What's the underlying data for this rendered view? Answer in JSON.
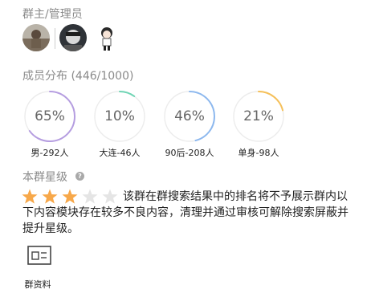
{
  "admins": {
    "title": "群主/管理员",
    "avatars": [
      {
        "kind": "photo-outdoor",
        "color": "#8d7e6e"
      },
      {
        "kind": "photo-dark",
        "color": "#4b4f55"
      },
      {
        "kind": "cartoon",
        "color": "#f1e9e5"
      }
    ]
  },
  "distribution": {
    "title": "成员分布 (446/1000)",
    "items": [
      {
        "value_text": "65%",
        "percent": 65,
        "label": "男-292人",
        "color": "#b59de0"
      },
      {
        "value_text": "10%",
        "percent": 10,
        "label": "大连-46人",
        "color": "#6fd4b4"
      },
      {
        "value_text": "46%",
        "percent": 46,
        "label": "90后-208人",
        "color": "#8db8ee"
      },
      {
        "value_text": "21%",
        "percent": 21,
        "label": "单身-98人",
        "color": "#f5c05a"
      }
    ],
    "track_color": "#ececec"
  },
  "rating": {
    "title": "本群星级",
    "help_icon": "question-circle-icon",
    "stars_total": 5,
    "stars_filled": 3,
    "filled_color": "#f7a84a",
    "empty_color": "#e5e5e5",
    "notice": "该群在群搜索结果中的排名将不予展示群内以下内容模块存在较多不良内容，清理并通过审核可解除搜索屏蔽并提升星级。"
  },
  "profile": {
    "icon": "id-card-icon",
    "label": "群资料"
  }
}
